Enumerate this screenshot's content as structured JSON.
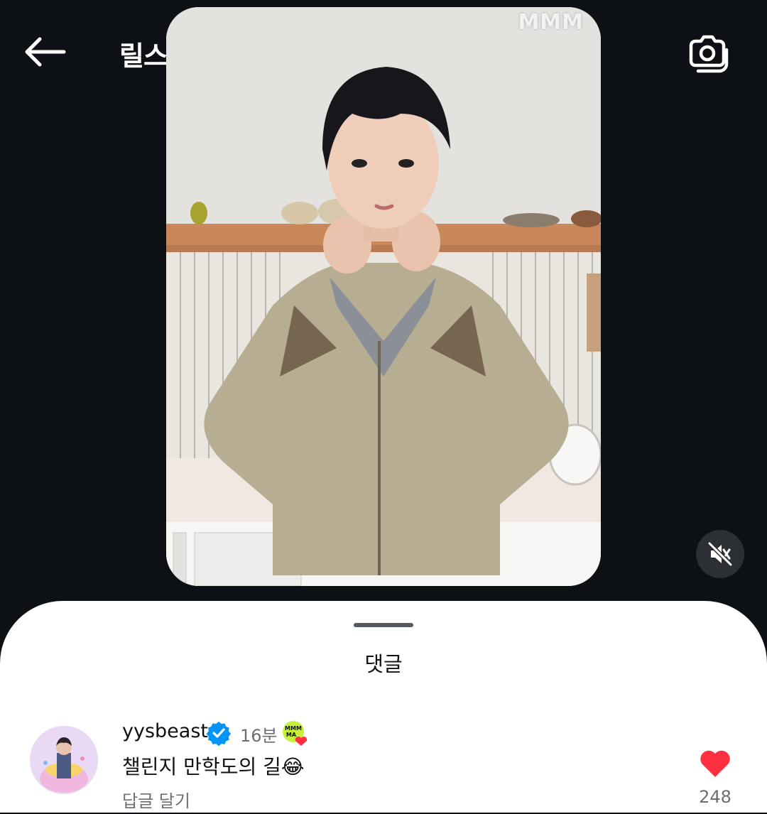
{
  "header": {
    "title": "릴스",
    "back_icon": "arrow-left-icon",
    "camera_icon": "camera-icon"
  },
  "video": {
    "watermark": "MMM",
    "mute_icon": "speaker-muted-icon"
  },
  "comments_sheet": {
    "title": "댓글",
    "comments": [
      {
        "username": "yysbeast",
        "verified": true,
        "time": "16분",
        "text": "챌린지 만학도의 길😂",
        "reply_label": "답글 달기",
        "likes": "248",
        "liked": true
      }
    ]
  },
  "colors": {
    "background": "#0d1014",
    "sheet": "#ffffff",
    "heart": "#ff3040",
    "verified": "#0095f6",
    "secondary_text": "#6b6f74"
  }
}
